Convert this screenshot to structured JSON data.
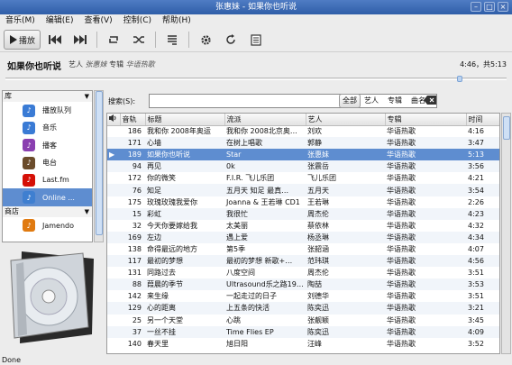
{
  "window": {
    "title": "张惠妹 - 如果你也听说"
  },
  "menu": [
    "音乐(M)",
    "编辑(E)",
    "查看(V)",
    "控制(C)",
    "帮助(H)"
  ],
  "toolbar": {
    "play_label": "播放"
  },
  "now_playing": {
    "title": "如果你也听说",
    "artist_prefix": "艺人",
    "artist": "张惠妹",
    "album_prefix": "专辑",
    "album": "华语热歌",
    "time": "4:46，共5:13",
    "progress": 0.91
  },
  "sidebar": {
    "library_header": "库",
    "library_items": [
      {
        "label": "播放队列",
        "icon": "play-queue-icon",
        "color": "#3a7bd5"
      },
      {
        "label": "音乐",
        "icon": "music-note-icon",
        "color": "#3a7bd5"
      },
      {
        "label": "播客",
        "icon": "podcast-icon",
        "color": "#8a3fb0"
      },
      {
        "label": "电台",
        "icon": "radio-icon",
        "color": "#6b4c2b"
      },
      {
        "label": "Last.fm",
        "icon": "lastfm-icon",
        "color": "#d51007"
      },
      {
        "label": "Online ...",
        "icon": "online-icon",
        "color": "#3f7fd0"
      }
    ],
    "store_header": "商店",
    "store_items": [
      {
        "label": "Jamendo",
        "icon": "jamendo-icon",
        "color": "#e07a10"
      }
    ]
  },
  "search": {
    "label": "搜索(S):",
    "value": "",
    "filters": [
      "全部",
      "艺人",
      "专辑",
      "曲名"
    ]
  },
  "table": {
    "columns": [
      "音轨",
      "标题",
      "流派",
      "艺人",
      "专辑",
      "时间"
    ],
    "rows": [
      [
        "186",
        "我和你 2008年奥运",
        "我和你 2008北京奥…",
        "刘欢",
        "华语热歌",
        "4:16"
      ],
      [
        "171",
        "心墙",
        "在树上唱歌",
        "郭静",
        "华语热歌",
        "3:47"
      ],
      [
        "189",
        "如果你也听说",
        "Star",
        "张惠妹",
        "华语热歌",
        "5:13"
      ],
      [
        "94",
        "再见",
        "0k",
        "张震岳",
        "华语热歌",
        "3:56"
      ],
      [
        "172",
        "你的微笑",
        "F.I.R. 飞儿乐团",
        "飞儿乐团",
        "华语热歌",
        "4:21"
      ],
      [
        "76",
        "知足",
        "五月天 知足 最真…",
        "五月天",
        "华语热歌",
        "3:54"
      ],
      [
        "175",
        "玫瑰玫瑰我爱你",
        "Joanna & 王若琳 CD1",
        "王若琳",
        "华语热歌",
        "2:26"
      ],
      [
        "15",
        "彩虹",
        "我很忙",
        "周杰伦",
        "华语热歌",
        "4:23"
      ],
      [
        "32",
        "今天你要嫁给我",
        "太美丽",
        "蔡依林",
        "华语热歌",
        "4:32"
      ],
      [
        "169",
        "左边",
        "遇上爱",
        "杨丞琳",
        "华语热歌",
        "4:34"
      ],
      [
        "138",
        "命得最远的地方",
        "第5季",
        "张韶涵",
        "华语热歌",
        "4:07"
      ],
      [
        "117",
        "最初的梦想",
        "最初的梦想 新歌+…",
        "范玮琪",
        "华语热歌",
        "4:56"
      ],
      [
        "131",
        "同路过去",
        "八度空间",
        "周杰伦",
        "华语热歌",
        "3:51"
      ],
      [
        "88",
        "葭晨的季节",
        "Ultrasound乐之路19…",
        "陶喆",
        "华语热歌",
        "3:53"
      ],
      [
        "142",
        "来生缘",
        "一起走过的日子",
        "刘德华",
        "华语热歌",
        "3:51"
      ],
      [
        "129",
        "心的距离",
        "上五条的快活",
        "陈奕迅",
        "华语热歌",
        "3:21"
      ],
      [
        "25",
        "另一个天堂",
        "心跳",
        "张靓颖",
        "华语热歌",
        "3:45"
      ],
      [
        "37",
        "一丝不挂",
        "Time Flies EP",
        "陈奕迅",
        "华语热歌",
        "4:09"
      ],
      [
        "140",
        "春天里",
        "旭日阳",
        "汪峰",
        "华语热歌",
        "3:52"
      ]
    ],
    "selected_index": 2,
    "playing_icon": "▶"
  },
  "status": {
    "text": "Done"
  },
  "colors": {
    "selection": "#5e8dd0",
    "title_bar": "#3a67b3"
  }
}
